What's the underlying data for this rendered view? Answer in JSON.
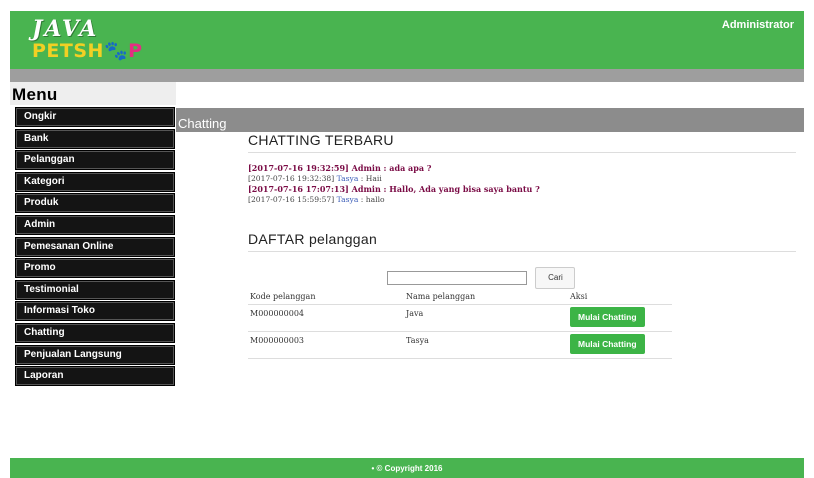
{
  "header": {
    "logo": {
      "line1": "JAVA",
      "pet": "PET",
      "shop": "SH",
      "paw": "🐾",
      "end": "P"
    },
    "admin_label": "Administrator"
  },
  "sidebar": {
    "title": "Menu",
    "items": [
      {
        "label": "Ongkir"
      },
      {
        "label": "Bank"
      },
      {
        "label": "Pelanggan"
      },
      {
        "label": "Kategori"
      },
      {
        "label": "Produk"
      },
      {
        "label": "Admin"
      },
      {
        "label": "Pemesanan Online"
      },
      {
        "label": "Promo"
      },
      {
        "label": "Testimonial"
      },
      {
        "label": "Informasi Toko"
      },
      {
        "label": "Chatting"
      },
      {
        "label": "Penjualan Langsung"
      },
      {
        "label": "Laporan"
      }
    ]
  },
  "main": {
    "section_header": "Chatting",
    "chat_title": "CHATTING TERBARU",
    "messages": [
      {
        "time": "[2017-07-16 19:32:59]",
        "sender": "Admin",
        "sep": " : ",
        "text": "ada apa ?",
        "is_admin": true
      },
      {
        "time": "[2017-07-16 19:32:38]",
        "sender": "Tasya",
        "sep": " : ",
        "text": "Haii",
        "is_admin": false
      },
      {
        "time": "[2017-07-16 17:07:13]",
        "sender": "Admin",
        "sep": " : ",
        "text": "Hallo, Ada yang bisa saya bantu ?",
        "is_admin": true
      },
      {
        "time": "[2017-07-16 15:59:57]",
        "sender": "Tasya",
        "sep": " : ",
        "text": "hallo",
        "is_admin": false
      }
    ],
    "customers_title": "DAFTAR pelanggan",
    "search": {
      "value": "",
      "button_label": "Cari"
    },
    "table": {
      "headers": [
        "Kode pelanggan",
        "Nama pelanggan",
        "Aksi"
      ],
      "rows": [
        {
          "code": "M000000004",
          "name": "Java",
          "action": "Mulai Chatting"
        },
        {
          "code": "M000000003",
          "name": "Tasya",
          "action": "Mulai Chatting"
        }
      ]
    }
  },
  "footer": {
    "text": "• © Copyright 2016"
  },
  "colors": {
    "brand_green": "#49b450",
    "menu_dark": "#141414",
    "admin_text": "#7a0b45",
    "user_link": "#3b5db8"
  }
}
